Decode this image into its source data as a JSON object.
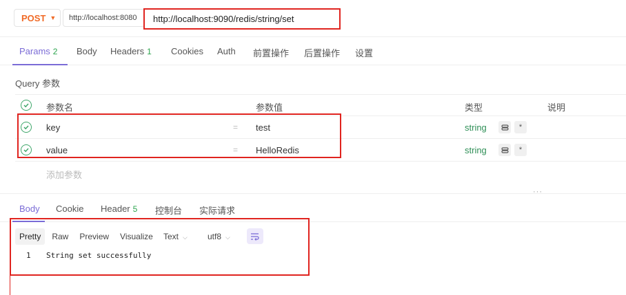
{
  "request": {
    "method": "POST",
    "env_url": "http://localhost:8080",
    "url": "http://localhost:9090/redis/string/set"
  },
  "request_tabs": [
    {
      "label": "Params",
      "count": "2"
    },
    {
      "label": "Body",
      "count": ""
    },
    {
      "label": "Headers",
      "count": "1"
    },
    {
      "label": "Cookies",
      "count": ""
    },
    {
      "label": "Auth",
      "count": ""
    },
    {
      "label": "前置操作",
      "count": ""
    },
    {
      "label": "后置操作",
      "count": ""
    },
    {
      "label": "设置",
      "count": ""
    }
  ],
  "query": {
    "title": "Query 参数",
    "columns": {
      "name": "参数名",
      "value": "参数值",
      "type": "类型",
      "desc": "说明"
    },
    "rows": [
      {
        "name": "key",
        "eq": "=",
        "value": "test",
        "type": "string",
        "required": "*"
      },
      {
        "name": "value",
        "eq": "=",
        "value": "HelloRedis",
        "type": "string",
        "required": "*"
      }
    ],
    "add_label": "添加参数"
  },
  "splitter_dots": "···",
  "response_tabs": [
    {
      "label": "Body",
      "count": ""
    },
    {
      "label": "Cookie",
      "count": ""
    },
    {
      "label": "Header",
      "count": "5"
    },
    {
      "label": "控制台",
      "count": ""
    },
    {
      "label": "实际请求",
      "count": ""
    }
  ],
  "response": {
    "formats": [
      "Pretty",
      "Raw",
      "Preview",
      "Visualize"
    ],
    "view_type": "Text",
    "encoding": "utf8",
    "line_number": "1",
    "body": "String set successfully"
  },
  "colors": {
    "accent": "#7a6bd6",
    "method": "#f06a26",
    "type": "#2f8f57",
    "highlight_box": "#e0231e"
  }
}
